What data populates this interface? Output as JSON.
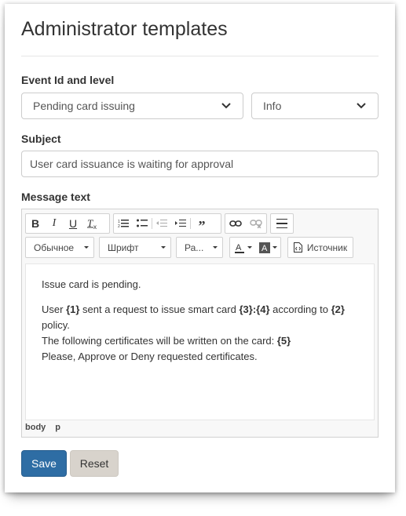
{
  "page": {
    "title": "Administrator templates"
  },
  "event": {
    "label": "Event Id and level",
    "event_value": "Pending card issuing",
    "level_value": "Info"
  },
  "subject": {
    "label": "Subject",
    "value": "User card issuance is waiting for approval"
  },
  "message": {
    "label": "Message text",
    "toolbar": {
      "format_label": "Обычное",
      "font_label": "Шрифт",
      "size_label": "Ра...",
      "source_label": "Источник"
    },
    "body": {
      "line1": "Issue card is pending.",
      "line2_a": "User ",
      "line2_p1": "{1}",
      "line2_b": " sent a request to issue smart card ",
      "line2_p3": "{3}",
      "line2_colon": ":",
      "line2_p4": "{4}",
      "line2_c": " according to ",
      "line2_p2": "{2}",
      "line2_d": " policy.",
      "line3_a": "The following certificates will be written on the card: ",
      "line3_p5": "{5}",
      "line4": "Please, Approve or Deny requested certificates."
    },
    "path": [
      "body",
      "p"
    ]
  },
  "actions": {
    "save_label": "Save",
    "reset_label": "Reset"
  },
  "icons": {
    "bold": "B",
    "italic": "I",
    "underline": "U",
    "remove_format": "Tx",
    "blockquote": "99"
  },
  "colors": {
    "primary": "#2e6da4",
    "reset": "#d8d3cc"
  }
}
